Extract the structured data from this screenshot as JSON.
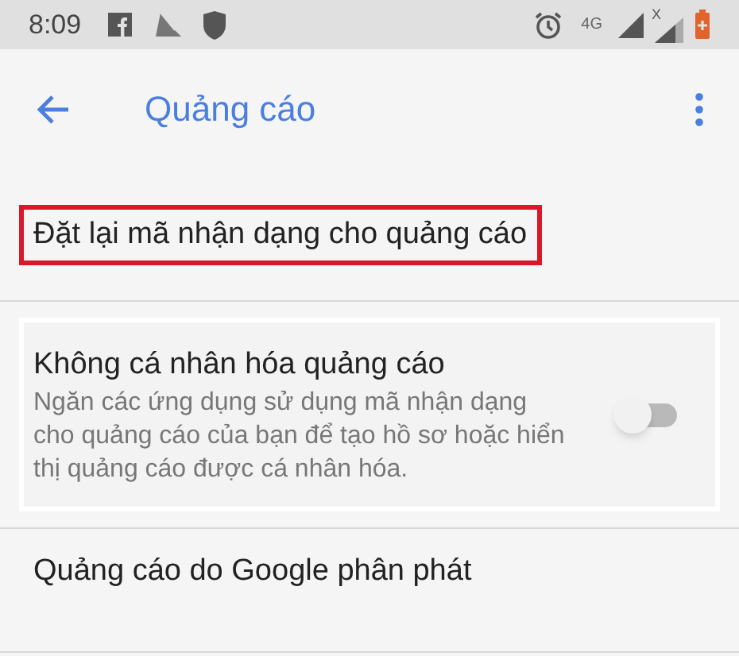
{
  "status_bar": {
    "time": "8:09",
    "network": "4G",
    "roaming_mark": "X"
  },
  "app_bar": {
    "title": "Quảng cáo"
  },
  "items": [
    {
      "kind": "link",
      "title": "Đặt lại mã nhận dạng cho quảng cáo",
      "highlighted": true
    },
    {
      "kind": "switch",
      "title": "Không cá nhân hóa quảng cáo",
      "summary": "Ngăn các ứng dụng sử dụng mã nhận dạng cho quảng cáo của bạn để tạo hồ sơ hoặc hiển thị quảng cáo được cá nhân hóa.",
      "on": false,
      "highlighted": false
    },
    {
      "kind": "link",
      "title": "Quảng cáo do Google phân phát",
      "highlighted": false
    }
  ]
}
